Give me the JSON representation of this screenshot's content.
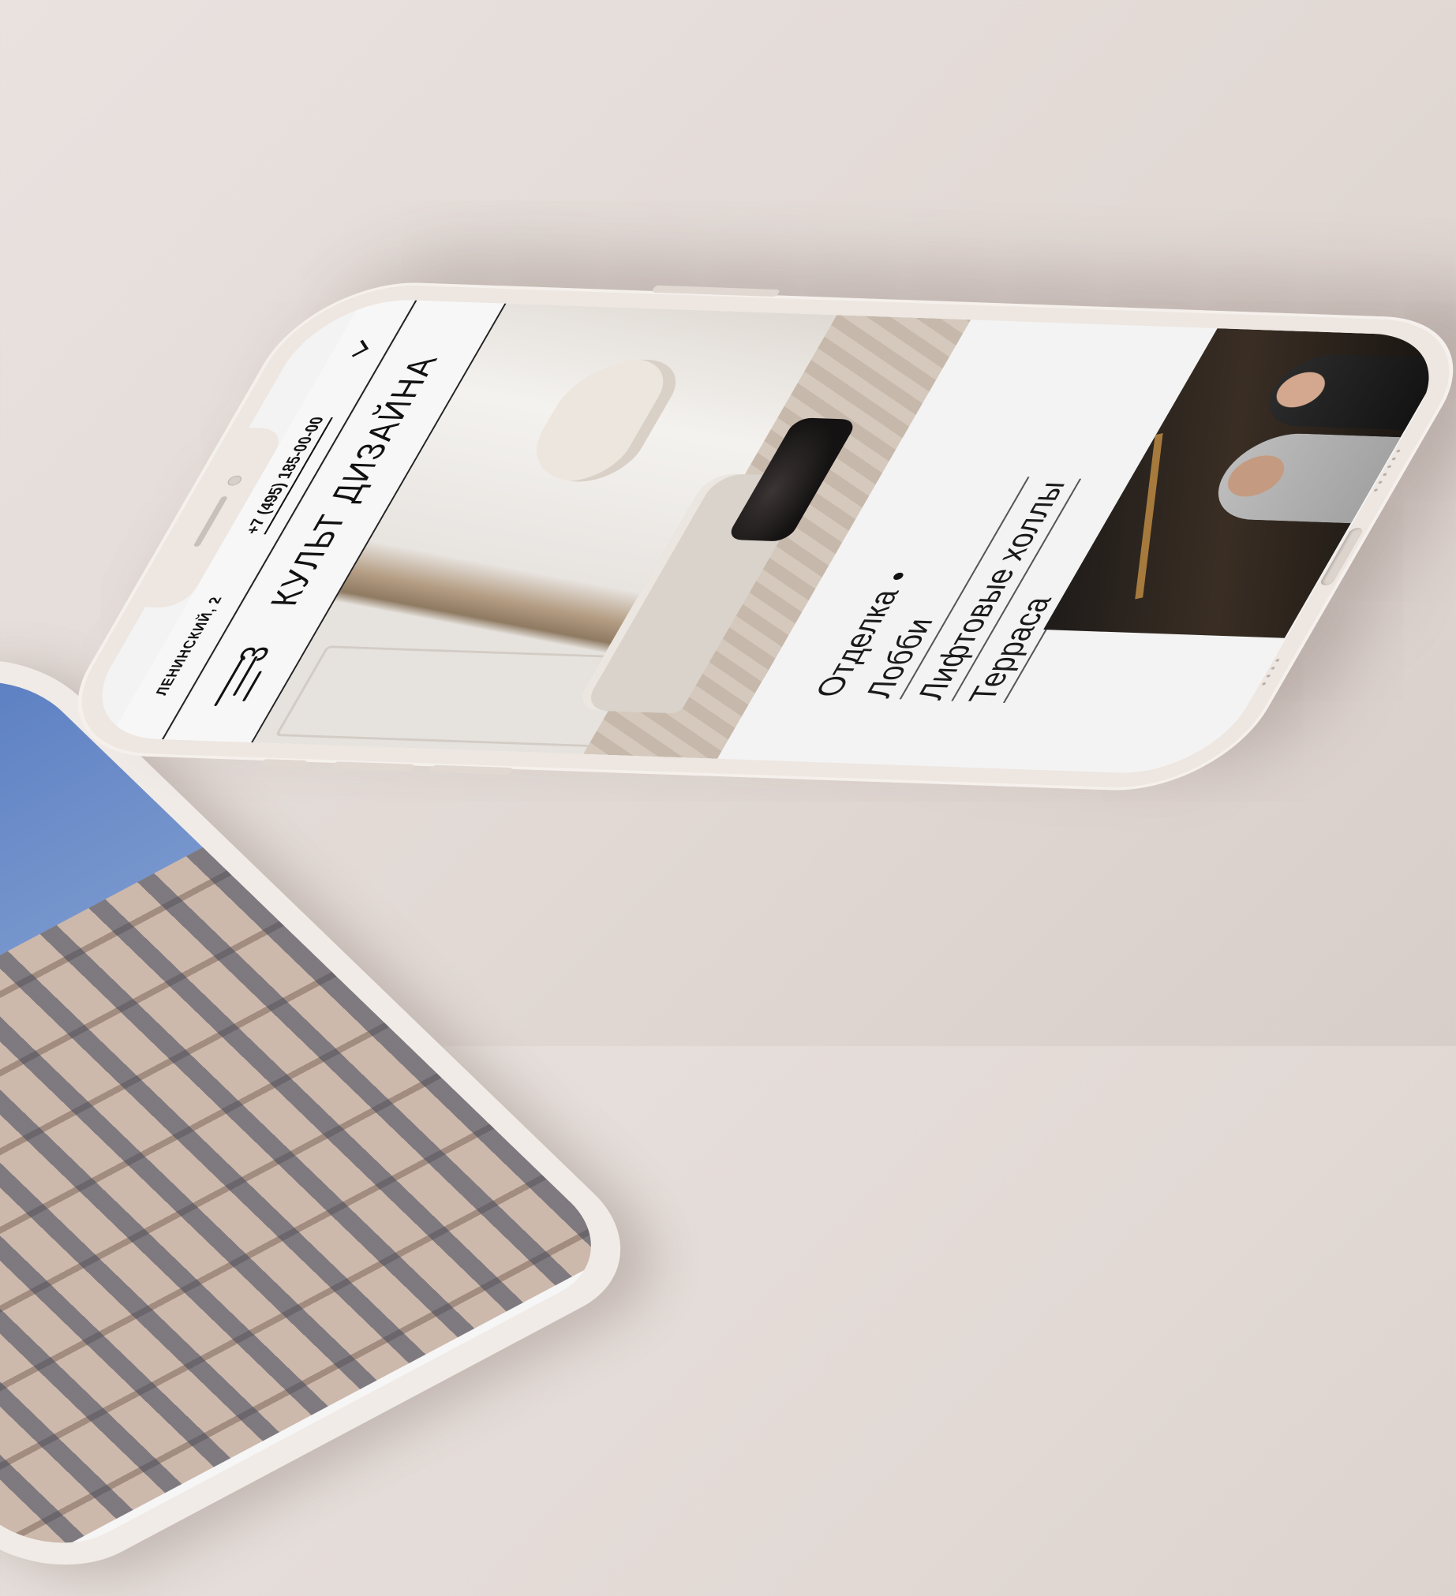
{
  "status_bar": {
    "address": "ЛЕНИНСКИЙ, 2",
    "phone": "+7 (495) 185-00-00"
  },
  "header": {
    "logo_number": "3",
    "logo_text": "КУЛЬТ ДИЗАЙНА"
  },
  "menu": {
    "items": [
      {
        "label": "Отделка"
      },
      {
        "label": "Лобби"
      },
      {
        "label": "Лифтовые холлы"
      },
      {
        "label": "Терраса"
      }
    ]
  },
  "colors": {
    "background": "#e2d9d5",
    "phone_body": "#ede6e1",
    "screen": "#f3f3f3",
    "text": "#111111"
  },
  "icons": {
    "menu": "hamburger-icon",
    "dropdown": "chevron-down-icon",
    "active_marker": "dot-icon"
  }
}
